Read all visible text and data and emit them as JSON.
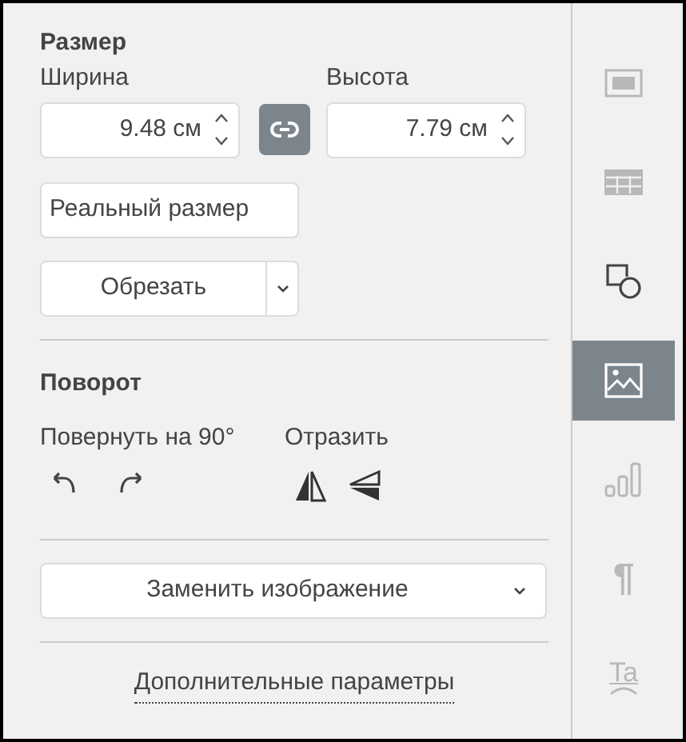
{
  "size": {
    "title": "Размер",
    "width_label": "Ширина",
    "width_value": "9.48 см",
    "height_label": "Высота",
    "height_value": "7.79 см",
    "aspect_locked": true,
    "actual_size_button": "Реальный размер",
    "crop_button": "Обрезать"
  },
  "rotation": {
    "title": "Поворот",
    "rotate_label": "Повернуть на 90°",
    "flip_label": "Отразить"
  },
  "replace_button": "Заменить изображение",
  "advanced_link": "Дополнительные параметры",
  "sidebar": [
    {
      "kind": "slide",
      "selected": false,
      "disabled": true
    },
    {
      "kind": "table",
      "selected": false,
      "disabled": true
    },
    {
      "kind": "shape",
      "selected": false,
      "disabled": false
    },
    {
      "kind": "image",
      "selected": true,
      "disabled": false
    },
    {
      "kind": "chart",
      "selected": false,
      "disabled": true
    },
    {
      "kind": "paragraph",
      "glyph": "¶",
      "selected": false,
      "disabled": true
    },
    {
      "kind": "textart",
      "glyph": "Ta",
      "selected": false,
      "disabled": true
    }
  ]
}
